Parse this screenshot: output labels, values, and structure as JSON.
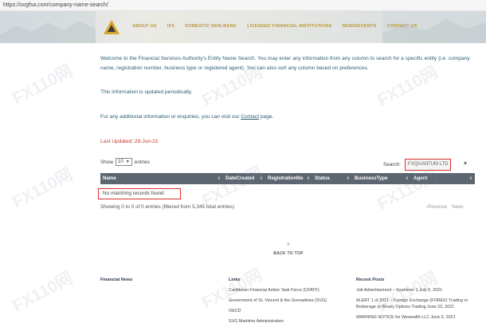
{
  "browser": {
    "url": "https://svgfsa.com/company-name-search/"
  },
  "nav": {
    "items": [
      "ABOUT US",
      "IFS",
      "DOMESTIC NON-BANK",
      "LICENSED FINANCIAL INSTITUTIONS",
      "NEWS/EVENTS",
      "CONTACT US"
    ]
  },
  "content": {
    "intro": "Welcome to the Financial Services Authority's Entity Name Search. You may enter any information from any column to search for a specific entity (i.e. company name, registration number, business type or registered agent). You can also sort any column based on preferences.",
    "updated_note": "This information is updated periodically.",
    "contact_prefix": "For any additional information or enquiries, you can visit our",
    "contact_link": "Contact",
    "contact_suffix": "page.",
    "last_updated_label": "Last Updated:",
    "last_updated_value": "28-Jun-21"
  },
  "table": {
    "show_label": "Show",
    "entries_value": "10",
    "entries_label": "entries",
    "search_label": "Search:",
    "search_value": "FXQUANTUM LTD",
    "clear_symbol": "×",
    "columns": [
      "Name",
      "DateCreated",
      "RegistrationNo",
      "Status",
      "BusinessType",
      "Agent"
    ],
    "empty_message": "No matching records found",
    "info": "Showing 0 to 0 of 0 entries (filtered from 5,345 total entries)",
    "prev": "Previous",
    "next": "Next"
  },
  "back_to_top": "BACK TO TOP",
  "footer": {
    "col1_title": "Financial News",
    "col2_title": "Links",
    "col2_items": [
      "Caribbean Financial Action Task Force (CFATF)",
      "Government of St. Vincent & the Grenadines (SVG)",
      "OECD",
      "SVG Maritime Administration"
    ],
    "col3_title": "Recent Posts",
    "col3_items": [
      "Job Advertisement – Examiner 1 July 6, 2021",
      "ALERT 1 of 2021 – Foreign Exchange (FOREX) Trading or Brokerage or Binary Options Trading June 23, 2021",
      "WARNING NOTICE for Wewealth LLC June 9, 2021"
    ]
  },
  "watermark": "FX110网",
  "colors": {
    "nav_gold": "#b89a3e",
    "header_gray": "#5c6670",
    "highlight_red": "#d9302c",
    "text_teal": "#2b5e73"
  }
}
